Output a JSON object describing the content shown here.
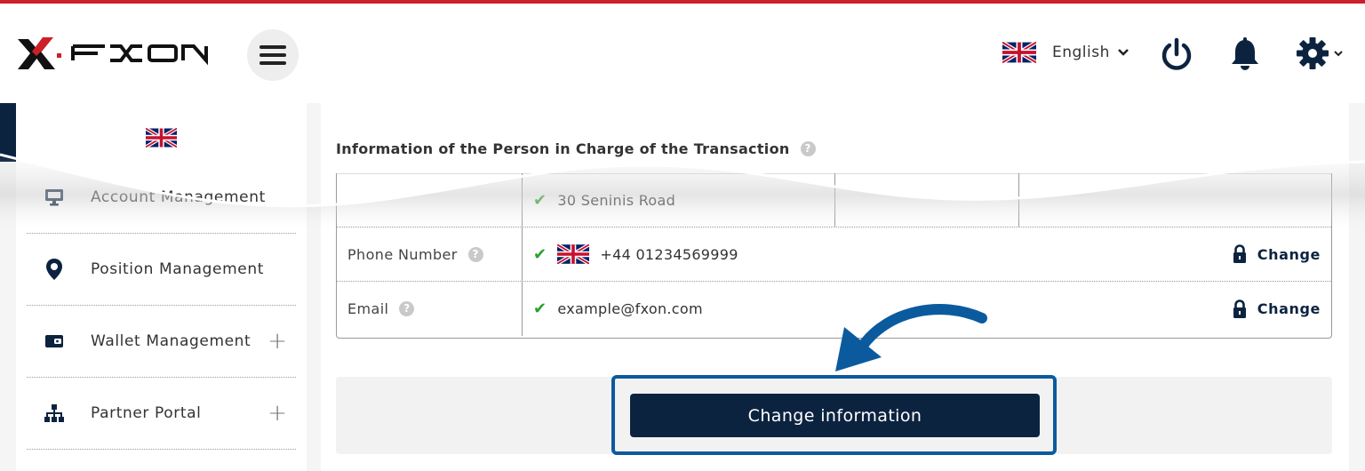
{
  "header": {
    "brand": "FXON",
    "language": "English"
  },
  "icons": {
    "logo": "fxon-logo",
    "menu": "hamburger-icon",
    "flag": "uk-flag-icon",
    "power": "power-icon",
    "notifications": "bell-icon",
    "settings": "gear-icon"
  },
  "sidebar": {
    "items": [
      {
        "label": "Account Management",
        "icon": "monitor-icon",
        "expandable": false
      },
      {
        "label": "Position Management",
        "icon": "location-pin-icon",
        "expandable": false
      },
      {
        "label": "Wallet Management",
        "icon": "wallet-icon",
        "expandable": true
      },
      {
        "label": "Partner Portal",
        "icon": "org-chart-icon",
        "expandable": true
      }
    ]
  },
  "section": {
    "title": "Information of the Person in Charge of the Transaction",
    "help": "?"
  },
  "table": {
    "address": "30 Seninis Road",
    "phone_label": "Phone Number",
    "phone_value": "+44 01234569999",
    "email_label": "Email",
    "email_value": "example@fxon.com",
    "change_label": "Change",
    "check": "✔"
  },
  "actions": {
    "change_info_label": "Change information"
  },
  "colors": {
    "accent_red": "#cc1f27",
    "navy": "#0c2340",
    "highlight_blue": "#0c5a9e",
    "check_green": "#2aa22a"
  }
}
